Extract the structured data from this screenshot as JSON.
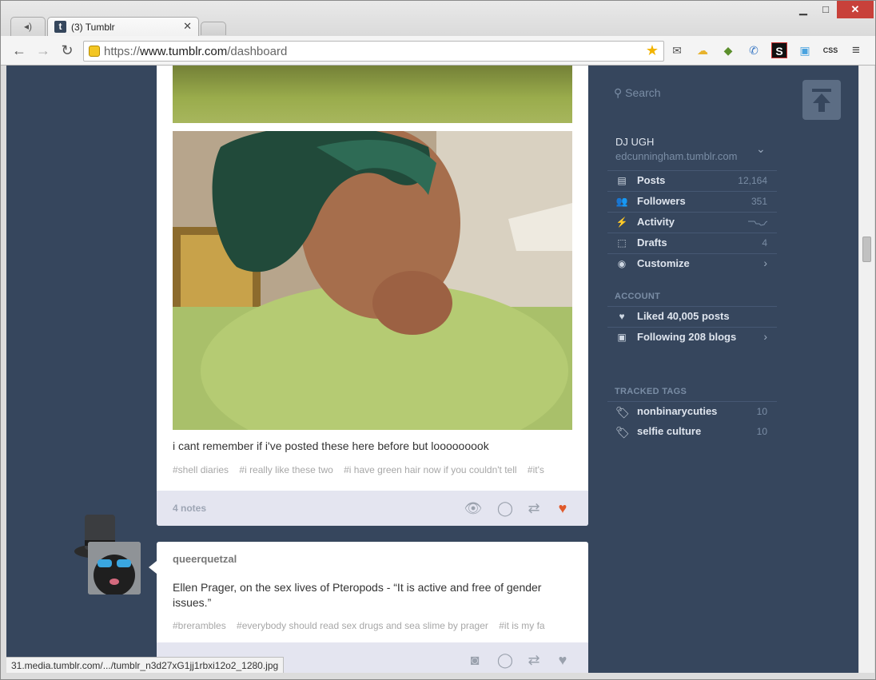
{
  "browser": {
    "tab_title": "(3) Tumblr",
    "tab_favicon": "t",
    "url_scheme": "https://",
    "url_host": "www.tumblr.com",
    "url_path": "/dashboard",
    "status_url": "31.media.tumblr.com/.../tumblr_n3d27xG1jj1rbxi12o2_1280.jpg",
    "window_controls": {
      "minimize": "▁",
      "maximize": "□",
      "close": "✕"
    }
  },
  "post1": {
    "caption": "i cant remember if i've posted these here before but looooooook",
    "tags": [
      "#shell diaries",
      "#i really like these two",
      "#i have green hair now if you couldn't tell",
      "#it's"
    ],
    "notes": "4 notes"
  },
  "post2": {
    "blog_name": "queerquetzal",
    "caption": "Ellen Prager, on the sex lives of Pteropods - “It is active and free of gender issues.”",
    "tags": [
      "#brerambles",
      "#everybody should read sex drugs and sea slime by prager",
      "#it is my fa"
    ]
  },
  "sidebar": {
    "search_placeholder": "Search",
    "blog_title": "DJ UGH",
    "blog_url": "edcunningham.tumblr.com",
    "items": [
      {
        "label": "Posts",
        "count": "12,164",
        "icon": "posts-icon"
      },
      {
        "label": "Followers",
        "count": "351",
        "icon": "followers-icon"
      },
      {
        "label": "Activity",
        "count": "",
        "icon": "activity-icon"
      },
      {
        "label": "Drafts",
        "count": "4",
        "icon": "drafts-icon"
      },
      {
        "label": "Customize",
        "count": "",
        "icon": "eye-icon"
      }
    ],
    "account_label": "ACCOUNT",
    "account_items": [
      {
        "label": "Liked 40,005 posts",
        "icon": "heart-icon"
      },
      {
        "label": "Following 208 blogs",
        "icon": "following-icon"
      }
    ],
    "tracked_label": "TRACKED TAGS",
    "tracked_tags": [
      {
        "label": "nonbinarycuties",
        "count": "10"
      },
      {
        "label": "selfie culture",
        "count": "10"
      }
    ]
  },
  "colors": {
    "dashboard_bg": "#36465d",
    "like_active": "#e0592a",
    "footer_bg": "#e4e5f0"
  }
}
